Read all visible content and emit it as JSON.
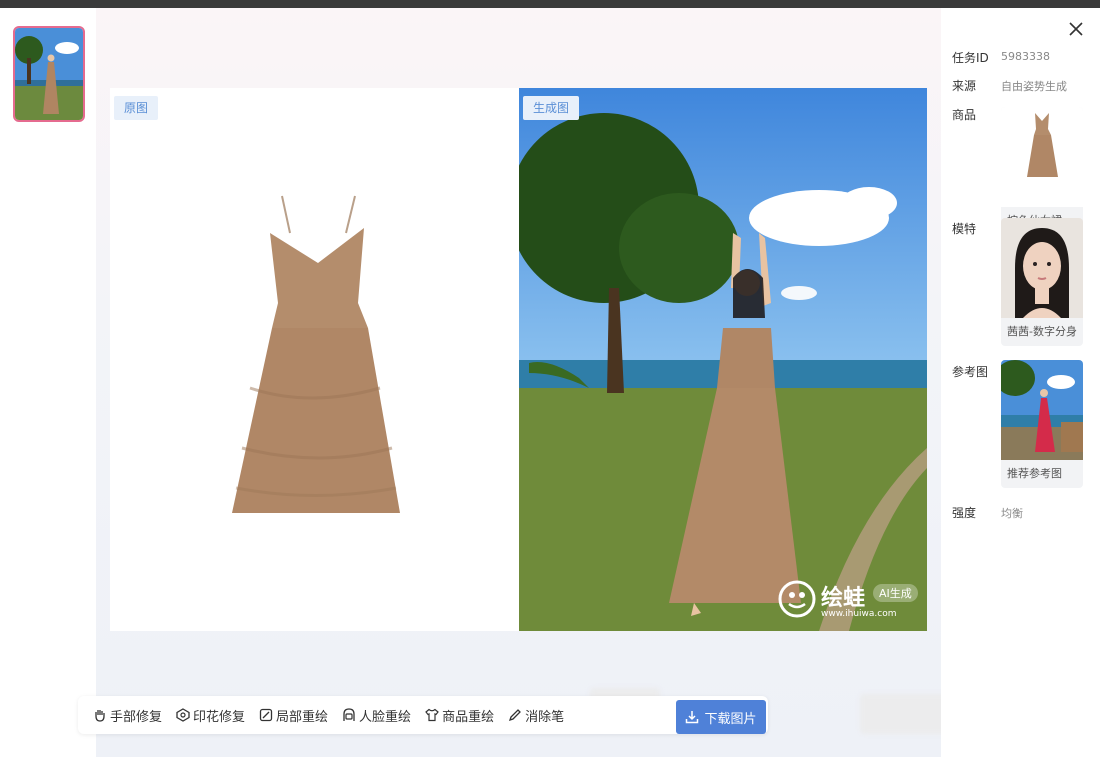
{
  "panels": {
    "original_tag": "原图",
    "generated_tag": "生成图"
  },
  "watermark": {
    "brand": "绘蛙",
    "badge": "AI生成",
    "url": "www.ihuiwa.com"
  },
  "toolbar": {
    "items": [
      {
        "label": "手部修复",
        "icon": "hand-icon"
      },
      {
        "label": "印花修复",
        "icon": "pattern-icon"
      },
      {
        "label": "局部重绘",
        "icon": "brush-area-icon"
      },
      {
        "label": "人脸重绘",
        "icon": "face-icon"
      },
      {
        "label": "商品重绘",
        "icon": "shirt-icon"
      },
      {
        "label": "消除笔",
        "icon": "pencil-icon"
      }
    ],
    "download_label": "下载图片"
  },
  "info": {
    "task_id_label": "任务ID",
    "task_id_value": "5983338",
    "source_label": "来源",
    "source_value": "自由姿势生成",
    "product_label": "商品",
    "product_caption": "棕色仙女裙-...",
    "model_label": "模特",
    "model_caption": "茜茜-数字分身",
    "reference_label": "参考图",
    "reference_caption": "推荐参考图",
    "strength_label": "强度",
    "strength_value": "均衡"
  },
  "colors": {
    "accent": "#4f81d8",
    "selected_border": "#e56b8f",
    "tag_text": "#5a8fd6"
  }
}
